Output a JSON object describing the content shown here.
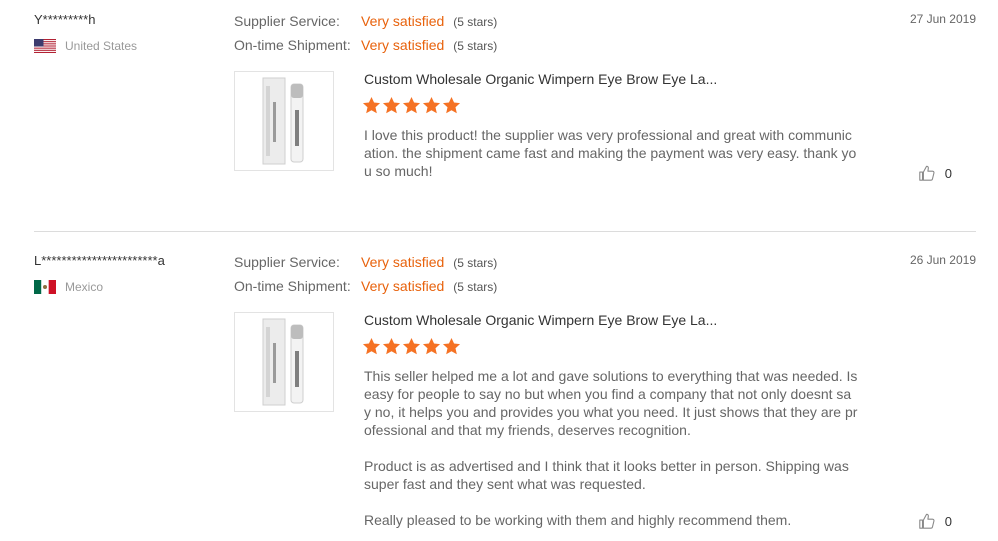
{
  "reviews": [
    {
      "user": "Y*********h",
      "country": "United States",
      "flag": "us",
      "supplier_label": "Supplier Service:",
      "supplier_value": "Very satisfied",
      "supplier_stars": "(5 stars)",
      "shipment_label": "On-time Shipment:",
      "shipment_value": "Very satisfied",
      "shipment_stars": "(5 stars)",
      "date": "27 Jun 2019",
      "product_title": "Custom Wholesale Organic Wimpern Eye Brow Eye La...",
      "rating": 5,
      "text": "I love this product! the supplier was very professional and great with communication. the shipment came fast and making the payment was very easy. thank you so much!",
      "likes": "0"
    },
    {
      "user": "L***********************a",
      "country": "Mexico",
      "flag": "mx",
      "supplier_label": "Supplier Service:",
      "supplier_value": "Very satisfied",
      "supplier_stars": "(5 stars)",
      "shipment_label": "On-time Shipment:",
      "shipment_value": "Very satisfied",
      "shipment_stars": "(5 stars)",
      "date": "26 Jun 2019",
      "product_title": "Custom Wholesale Organic Wimpern Eye Brow Eye La...",
      "rating": 5,
      "text": "This seller helped me a lot and gave solutions to everything that was needed. Is easy for people to say no but when you find a company that not only doesnt say no, it helps you and provides you what you need. It just shows that they are professional and that my friends, deserves recognition.\n\nProduct is as advertised and I think that it looks better in person. Shipping was super fast and they sent what was requested.\n\nReally pleased to be working with them and highly recommend them.",
      "likes": "0"
    }
  ],
  "colors": {
    "accent": "#e8620c",
    "star": "#f57224",
    "divider": "#dcdcdc"
  }
}
